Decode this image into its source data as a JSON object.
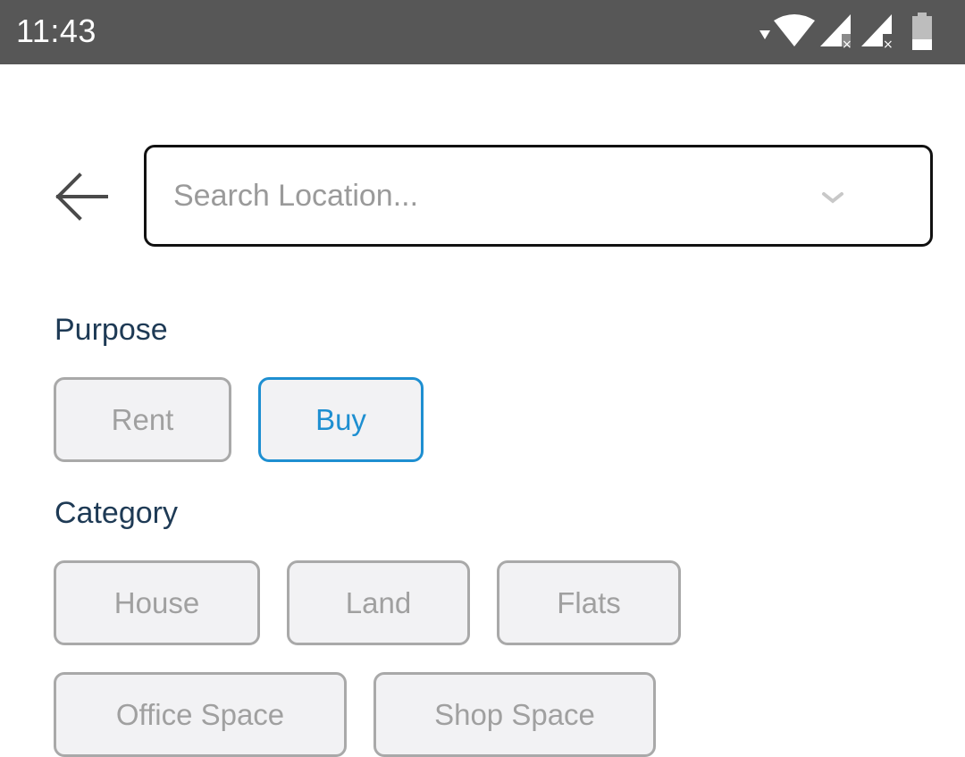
{
  "status_bar": {
    "time": "11:43",
    "icons": [
      "wifi-icon",
      "signal-icon",
      "signal-icon",
      "battery-icon"
    ]
  },
  "search": {
    "placeholder": "Search Location...",
    "value": ""
  },
  "purpose": {
    "label": "Purpose",
    "options": [
      {
        "label": "Rent",
        "selected": false
      },
      {
        "label": "Buy",
        "selected": true
      }
    ]
  },
  "category": {
    "label": "Category",
    "options": [
      {
        "label": "House",
        "selected": false
      },
      {
        "label": "Land",
        "selected": false
      },
      {
        "label": "Flats",
        "selected": false
      },
      {
        "label": "Office Space",
        "selected": false
      },
      {
        "label": "Shop Space",
        "selected": false
      }
    ]
  },
  "colors": {
    "status_bar_bg": "#575757",
    "accent": "#1e8fd1",
    "label_text": "#1e3a55",
    "chip_bg": "#f2f2f4",
    "chip_border": "#a9a9a9"
  }
}
